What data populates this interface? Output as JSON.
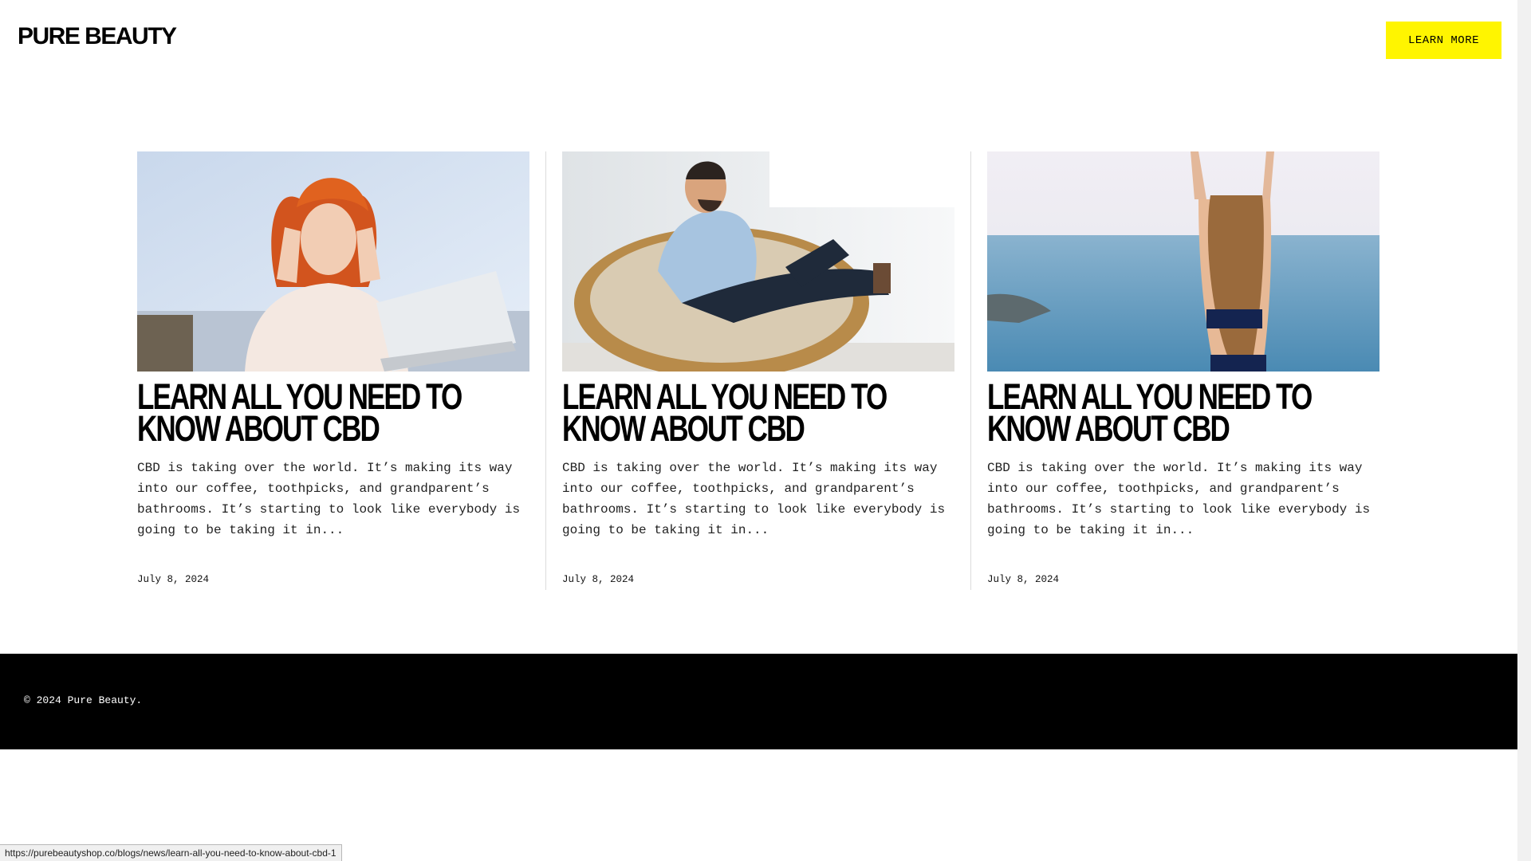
{
  "header": {
    "logo": "PURE BEAUTY",
    "cta_label": "LEARN MORE",
    "cta_color": "#fff500"
  },
  "articles": [
    {
      "title": "LEARN ALL YOU NEED TO KNOW ABOUT CBD",
      "excerpt": "CBD is taking over the world. It’s making its way into our coffee, toothpicks, and grandparent’s bathrooms. It’s starting to look like everybody is going to be taking it in...",
      "date": "July 8, 2024",
      "image": "woman-stressed-at-laptop"
    },
    {
      "title": "LEARN ALL YOU NEED TO KNOW ABOUT CBD",
      "excerpt": "CBD is taking over the world. It’s making its way into our coffee, toothpicks, and grandparent’s bathrooms. It’s starting to look like everybody is going to be taking it in...",
      "date": "July 8, 2024",
      "image": "man-relaxing-in-chair"
    },
    {
      "title": "LEARN ALL YOU NEED TO KNOW ABOUT CBD",
      "excerpt": "CBD is taking over the world. It’s making its way into our coffee, toothpicks, and grandparent’s bathrooms. It’s starting to look like everybody is going to be taking it in...",
      "date": "July 8, 2024",
      "image": "woman-stretching-by-sea"
    }
  ],
  "footer": {
    "copyright": "© 2024 Pure Beauty."
  },
  "status_bar": {
    "url": "https://purebeautyshop.co/blogs/news/learn-all-you-need-to-know-about-cbd-1"
  }
}
